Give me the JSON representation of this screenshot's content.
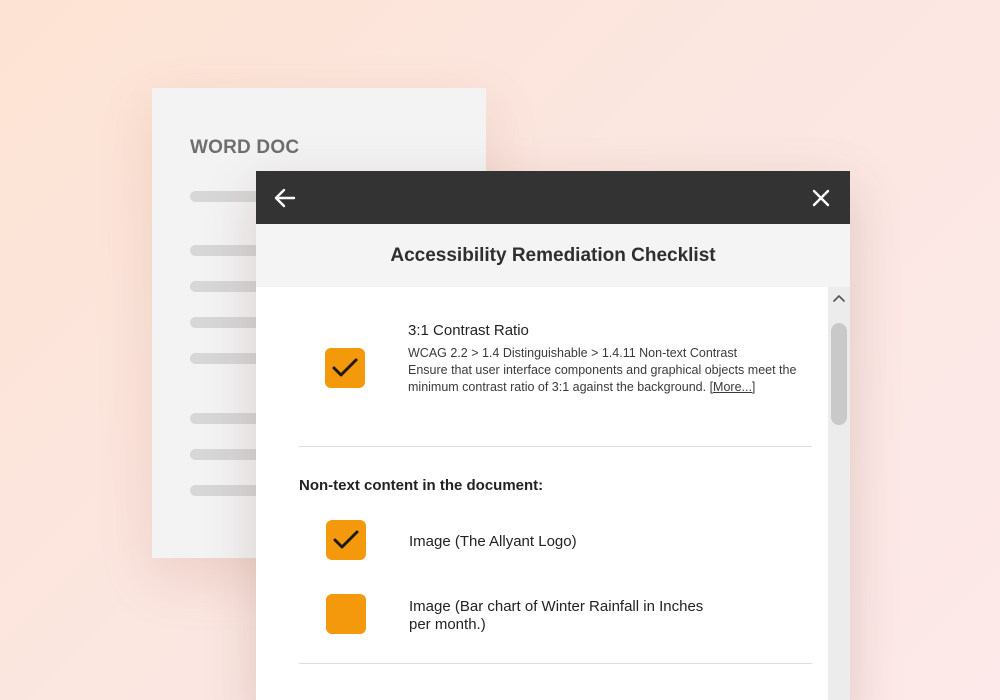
{
  "word_doc": {
    "title": "WORD DOC"
  },
  "panel": {
    "title": "Accessibility Remediation Checklist",
    "back_icon": "arrow-left-icon",
    "close_icon": "close-icon"
  },
  "checklist": {
    "contrast_item": {
      "title": "3:1 Contrast Ratio",
      "reference": "WCAG 2.2 > 1.4 Distinguishable > 1.4.11 Non-text Contrast",
      "description": "Ensure that user interface components and graphical objects meet the minimum contrast ratio of 3:1 against the background.",
      "more_link": "[More...]",
      "checked": true
    },
    "section_heading": "Non-text content in the document:",
    "items": [
      {
        "label": "Image (The Allyant Logo)",
        "checked": true
      },
      {
        "label": "Image (Bar chart of Winter Rainfall in Inches per month.)",
        "checked": false
      }
    ]
  },
  "colors": {
    "accent": "#f5990c",
    "topbar": "#333333"
  }
}
